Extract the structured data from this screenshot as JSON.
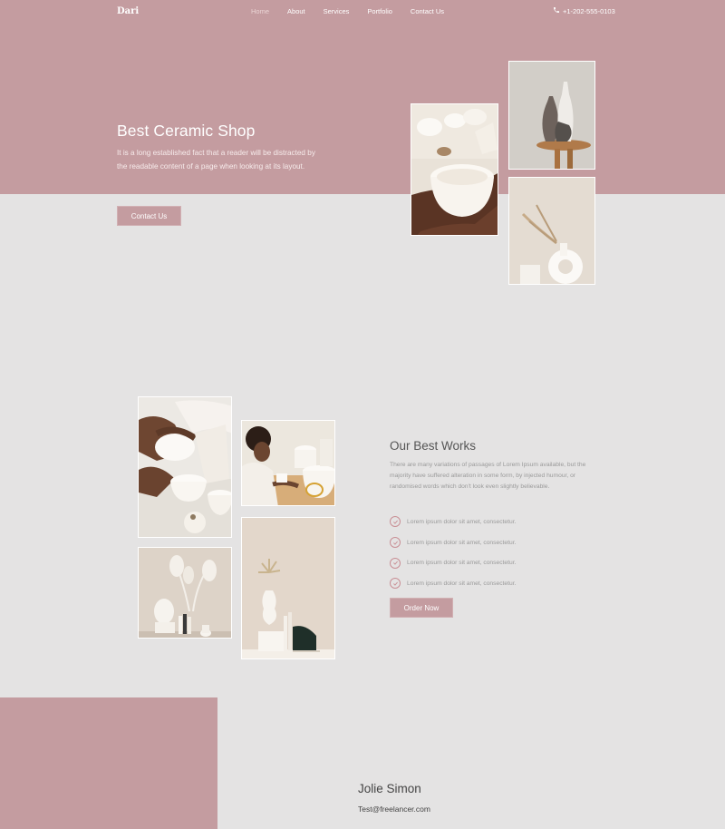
{
  "nav": {
    "brand": "Dari",
    "links": [
      "Home",
      "About",
      "Services",
      "Portfolio",
      "Contact Us"
    ],
    "active": "Home",
    "phone_icon": "phone-icon",
    "phone": "+1-202-555-0103"
  },
  "hero": {
    "title": "Best Ceramic Shop",
    "text": "It is a long established fact that a reader will be distracted by the readable content of a page when looking at its layout.",
    "button": "Contact Us"
  },
  "works": {
    "title": "Our Best Works",
    "text": "There are many variations of passages of Lorem Ipsum available, but the majority have suffered alteration in some form, by injected humour, or randomised words which don't look even slightly believable.",
    "items": [
      "Lorem ipsum dolor sit amet, consectetur.",
      "Lorem ipsum dolor sit amet, consectetur.",
      "Lorem ipsum dolor sit amet, consectetur.",
      "Lorem ipsum dolor sit amet, consectetur."
    ],
    "check_icon": "check-circle-icon",
    "button": "Order Now"
  },
  "contact": {
    "name": "Jolie Simon",
    "email": "Test@freelancer.com"
  },
  "colors": {
    "accent": "#c49ca0",
    "background": "#e4e3e3"
  }
}
